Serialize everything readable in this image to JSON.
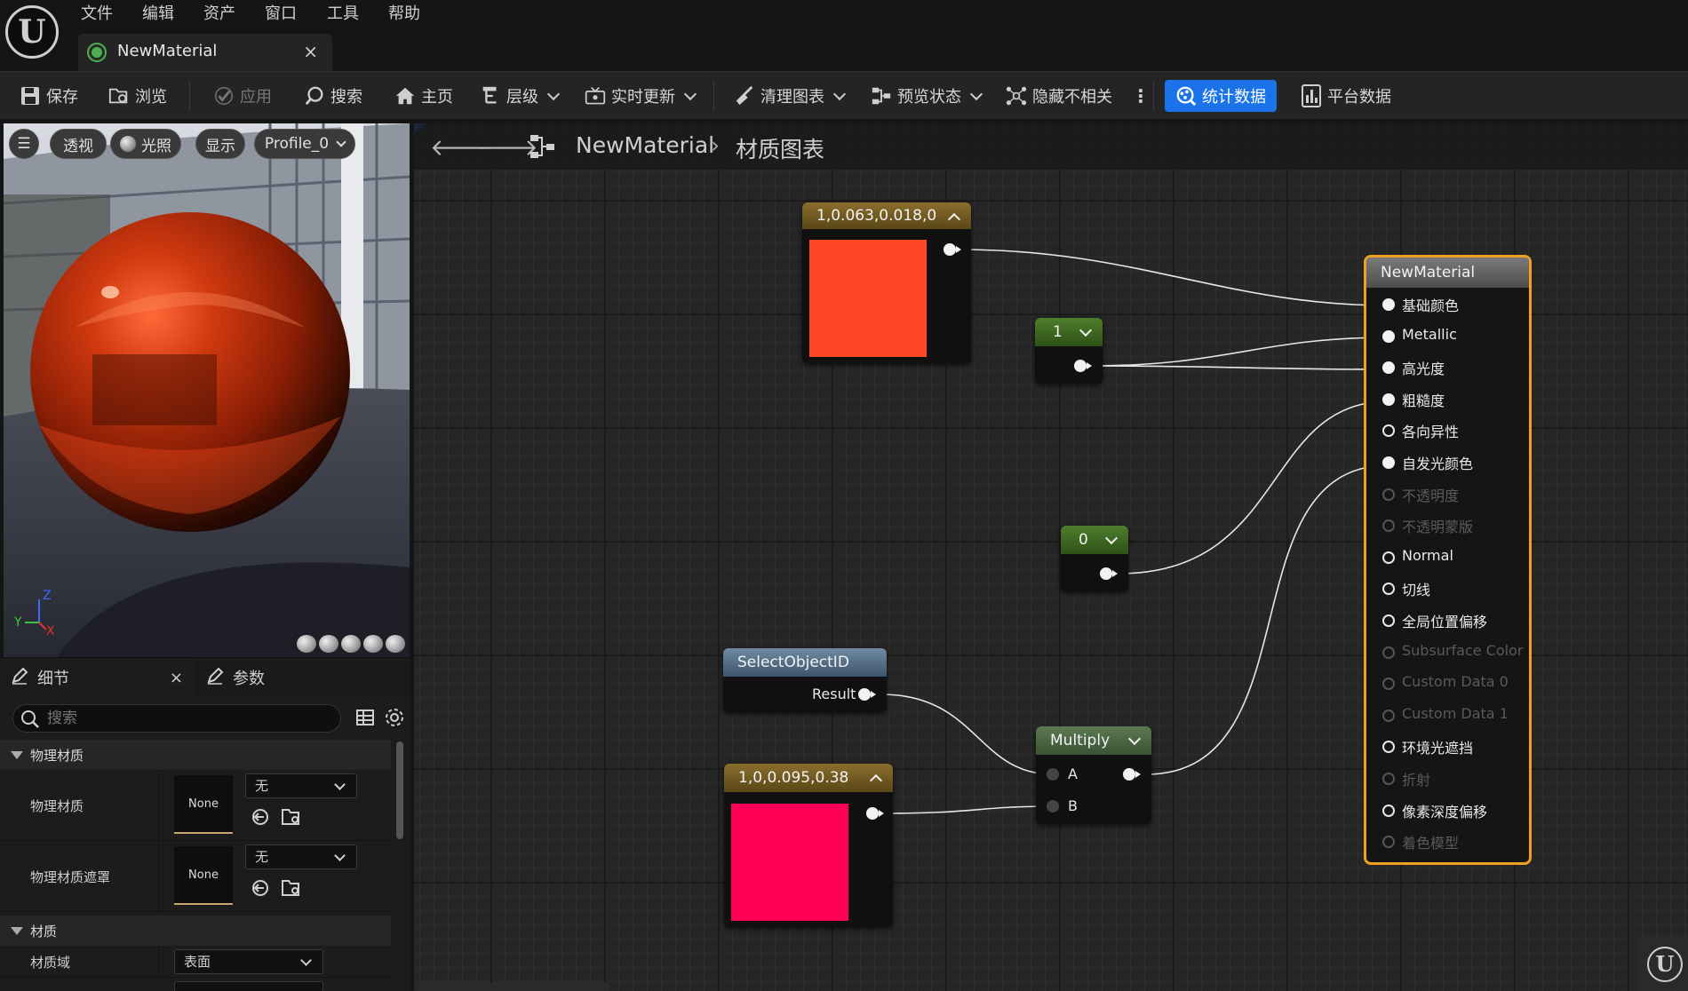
{
  "menu": {
    "items": [
      "文件",
      "编辑",
      "资产",
      "窗口",
      "工具",
      "帮助"
    ]
  },
  "doc_tab": {
    "title": "NewMaterial",
    "close": "×"
  },
  "toolbar": {
    "save": "保存",
    "browse": "浏览",
    "apply": "应用",
    "search": "搜索",
    "home": "主页",
    "hierarchy": "层级",
    "live_update": "实时更新",
    "clean_graph": "清理图表",
    "preview_state": "预览状态",
    "hide_unrelated": "隐藏不相关",
    "more": "⋮",
    "stats": "统计数据",
    "platform_stats": "平台数据"
  },
  "viewport": {
    "menu": "☰",
    "perspective": "透视",
    "lit": "光照",
    "show": "显示",
    "profile": "Profile_0",
    "axis_z": "Z",
    "axis_y": "Y",
    "axis_x": "X"
  },
  "details": {
    "tab_details": "细节",
    "tab_close": "×",
    "tab_params": "参数",
    "search_placeholder": "搜索",
    "section_physical": "物理材质",
    "prop_physical_material": "物理材质",
    "prop_physical_material_mask": "物理材质遮罩",
    "thumb_none": "None",
    "dropdown_none": "无",
    "section_material": "材质",
    "prop_material_domain": "材质域",
    "material_domain_value": "表面"
  },
  "graph": {
    "back": "🡐",
    "forward": "🡒",
    "breadcrumb_root": "NewMaterial",
    "breadcrumb_sep": "›",
    "breadcrumb_current": "材质图表"
  },
  "nodes": {
    "const3_a": {
      "title": "1,0.063,0.018,0",
      "color": "#ff4726"
    },
    "const_1": {
      "title": "1"
    },
    "const_0": {
      "title": "0"
    },
    "select_object_id": {
      "title": "SelectObjectID",
      "pin_result": "Result"
    },
    "const3_b": {
      "title": "1,0,0.095,0.38",
      "color": "#ff0055"
    },
    "multiply": {
      "title": "Multiply",
      "pin_a": "A",
      "pin_b": "B"
    },
    "main": {
      "title": "NewMaterial",
      "inputs": [
        {
          "label": "基础颜色",
          "enabled": true,
          "connected": true
        },
        {
          "label": "Metallic",
          "enabled": true,
          "connected": true
        },
        {
          "label": "高光度",
          "enabled": true,
          "connected": true
        },
        {
          "label": "粗糙度",
          "enabled": true,
          "connected": true
        },
        {
          "label": "各向异性",
          "enabled": true,
          "connected": false
        },
        {
          "label": "自发光颜色",
          "enabled": true,
          "connected": true
        },
        {
          "label": "不透明度",
          "enabled": false,
          "connected": false
        },
        {
          "label": "不透明蒙版",
          "enabled": false,
          "connected": false
        },
        {
          "label": "Normal",
          "enabled": true,
          "connected": false
        },
        {
          "label": "切线",
          "enabled": true,
          "connected": false
        },
        {
          "label": "全局位置偏移",
          "enabled": true,
          "connected": false
        },
        {
          "label": "Subsurface Color",
          "enabled": false,
          "connected": false
        },
        {
          "label": "Custom Data 0",
          "enabled": false,
          "connected": false
        },
        {
          "label": "Custom Data 1",
          "enabled": false,
          "connected": false
        },
        {
          "label": "环境光遮挡",
          "enabled": true,
          "connected": false
        },
        {
          "label": "折射",
          "enabled": false,
          "connected": false
        },
        {
          "label": "像素深度偏移",
          "enabled": true,
          "connected": false
        },
        {
          "label": "着色模型",
          "enabled": false,
          "connected": false
        }
      ]
    }
  },
  "colors": {
    "accent": "#1a73e8",
    "main_node_border": "#f0a020"
  }
}
